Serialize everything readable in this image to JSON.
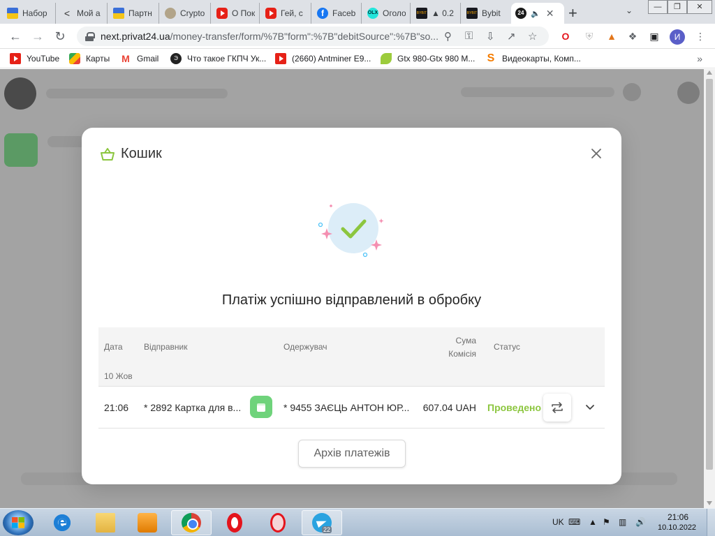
{
  "browser": {
    "tabs": [
      {
        "label": "Набор",
        "icon": "ukraine-flag-icon"
      },
      {
        "label": "Мой а",
        "icon": "share-icon"
      },
      {
        "label": "Партн",
        "icon": "ukraine-flag-icon"
      },
      {
        "label": "Crypto",
        "icon": "crypto-icon"
      },
      {
        "label": "О Пок",
        "icon": "youtube-icon"
      },
      {
        "label": "Гей, с",
        "icon": "youtube-icon"
      },
      {
        "label": "Faceb",
        "icon": "facebook-icon"
      },
      {
        "label": "Оголо",
        "icon": "olx-icon"
      },
      {
        "label": "▲ 0.2",
        "icon": "bybit-icon"
      },
      {
        "label": "Bybit",
        "icon": "bybit-icon"
      },
      {
        "label": "",
        "icon": "privat24-icon",
        "active": true
      }
    ],
    "olx_glyph": "OLX",
    "bybit_glyph": "BYBIT",
    "p24_glyph": "24",
    "fb_glyph": "f",
    "new_tab": "+",
    "url_host": "next.privat24.ua",
    "url_path": "/money-transfer/form/%7B\"form\":%7B\"debitSource\":%7B\"so...",
    "profile_initial": "И",
    "bookmarks": [
      {
        "label": "YouTube",
        "icon": "youtube-icon"
      },
      {
        "label": "Карты",
        "icon": "maps-icon"
      },
      {
        "label": "Gmail",
        "icon": "gmail-icon"
      },
      {
        "label": "Что такое ГКПЧ Ук...",
        "icon": "gkpch-icon"
      },
      {
        "label": "(2660) Antminer E9...",
        "icon": "youtube-icon"
      },
      {
        "label": "Gtx 980-Gtx 980 M...",
        "icon": "leaf-icon"
      },
      {
        "label": "Видеокарты, Комп...",
        "icon": "s-icon"
      }
    ],
    "gmail_glyph": "M",
    "gkpch_glyph": "Э",
    "s_glyph": "S",
    "bookmarks_more": "»"
  },
  "modal": {
    "title": "Кошик",
    "headline": "Платіж успішно відправлений в обробку",
    "table": {
      "headers": {
        "date": "Дата",
        "sender": "Відправник",
        "recipient": "Одержувач",
        "amount": "Сума",
        "fee": "Комісія",
        "status": "Статус"
      },
      "group_date": "10 Жов",
      "rows": [
        {
          "time": "21:06",
          "sender": "* 2892 Картка для в...",
          "recipient": "* 9455 ЗАЄЦЬ АНТОН ЮР...",
          "amount": "607.04 UAH",
          "status": "Проведено"
        }
      ]
    },
    "archive_button": "Архів платежів"
  },
  "taskbar": {
    "ie_glyph": "e",
    "tg_badge": "22",
    "lang": "UK",
    "time": "21:06",
    "date": "10.10.2022"
  },
  "colors": {
    "accent_green": "#8cc63f",
    "check_bg": "#dcedf8",
    "sparkle_pink": "#f48fb1",
    "sparkle_blue": "#4fc3f7"
  }
}
